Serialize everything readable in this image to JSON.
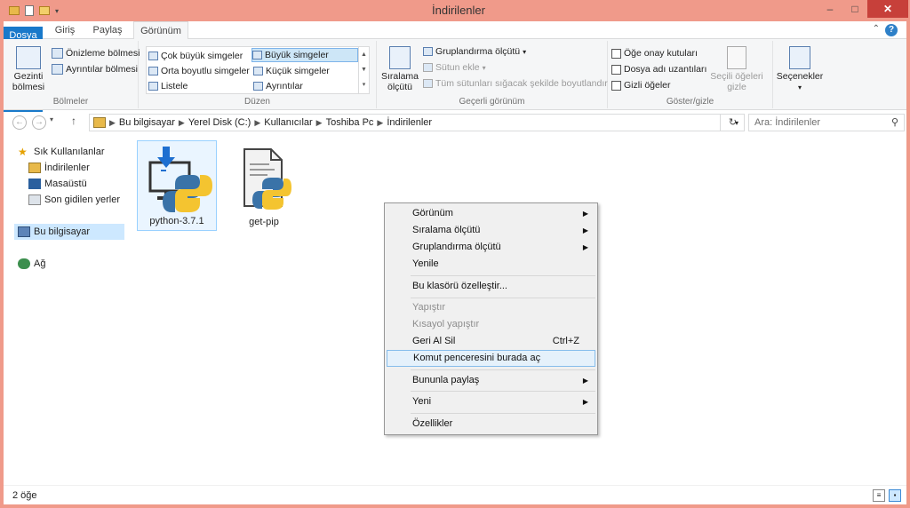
{
  "window": {
    "title": "İndirilenler",
    "minimize": "–",
    "maximize": "□",
    "close": "✕"
  },
  "tabs": [
    {
      "label": "Dosya"
    },
    {
      "label": "Giriş"
    },
    {
      "label": "Paylaş"
    },
    {
      "label": "Görünüm"
    }
  ],
  "ribbon": {
    "panes": {
      "nav_pane": "Gezinti bölmesi",
      "preview": "Önizleme bölmesi",
      "details": "Ayrıntılar bölmesi",
      "label": "Bölmeler"
    },
    "layout": {
      "items": [
        "Çok büyük simgeler",
        "Büyük simgeler",
        "Orta boyutlu simgeler",
        "Küçük simgeler",
        "Listele",
        "Ayrıntılar"
      ],
      "selected": "Büyük simgeler",
      "label": "Düzen"
    },
    "current_view": {
      "sort": "Sıralama ölçütü",
      "group": "Gruplandırma ölçütü",
      "add_column": "Sütun ekle",
      "fit_columns": "Tüm sütunları sığacak şekilde boyutlandır",
      "label": "Geçerli görünüm"
    },
    "show_hide": {
      "checkboxes": "Öğe onay kutuları",
      "extensions": "Dosya adı uzantıları",
      "hidden": "Gizli öğeler",
      "hide_selected": "Seçili öğeleri gizle",
      "label": "Göster/gizle"
    },
    "options": "Seçenekler"
  },
  "address": {
    "crumbs": [
      "Bu bilgisayar",
      "Yerel Disk (C:)",
      "Kullanıcılar",
      "Toshiba Pc",
      "İndirilenler"
    ],
    "search_placeholder": "Ara: İndirilenler"
  },
  "nav": {
    "favorites": "Sık Kullanılanlar",
    "downloads": "İndirilenler",
    "desktop": "Masaüstü",
    "recent": "Son gidilen yerler",
    "this_pc": "Bu bilgisayar",
    "network": "Ağ"
  },
  "files": [
    {
      "name": "python-3.7.1"
    },
    {
      "name": "get-pip"
    }
  ],
  "status": {
    "count": "2 öğe"
  },
  "context_menu": {
    "view": "Görünüm",
    "sort": "Sıralama ölçütü",
    "group": "Gruplandırma ölçütü",
    "refresh": "Yenile",
    "customize": "Bu klasörü özelleştir...",
    "paste": "Yapıştır",
    "paste_shortcut": "Kısayol yapıştır",
    "undo": "Geri Al Sil",
    "undo_shortcut": "Ctrl+Z",
    "cmd": "Komut penceresini burada aç",
    "share": "Bununla paylaş",
    "new": "Yeni",
    "properties": "Özellikler"
  },
  "colors": {
    "title_bar": "#f09a8a",
    "file_tab": "#1979ca",
    "selection": "#cde8ff"
  }
}
